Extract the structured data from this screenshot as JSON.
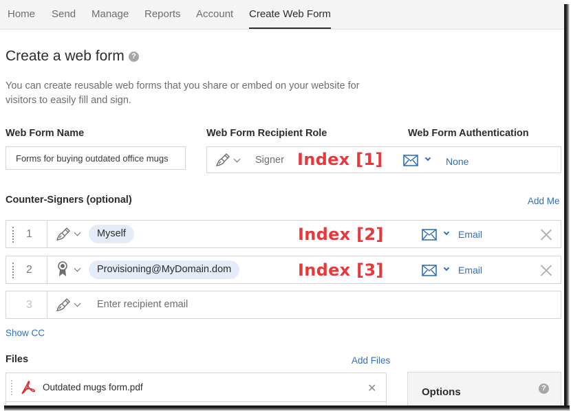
{
  "nav": {
    "items": [
      {
        "label": "Home",
        "active": false
      },
      {
        "label": "Send",
        "active": false
      },
      {
        "label": "Manage",
        "active": false
      },
      {
        "label": "Reports",
        "active": false
      },
      {
        "label": "Account",
        "active": false
      },
      {
        "label": "Create Web Form",
        "active": true
      }
    ]
  },
  "page": {
    "title": "Create a web form",
    "help_icon": "question-circle-icon",
    "description": "You can create reusable web forms that you share or embed on your website for visitors to easily fill and sign."
  },
  "web_form": {
    "name_label": "Web Form Name",
    "name_value": "Forms for buying outdated office mugs",
    "role_label": "Web Form Recipient Role",
    "auth_label": "Web Form Authentication",
    "recipient": {
      "role_icon": "pen-signer-icon",
      "role": "Signer",
      "annotation": "Index [1]",
      "auth_icon": "envelope-icon",
      "auth": "None"
    }
  },
  "counter_signers": {
    "label": "Counter-Signers (optional)",
    "add_me": "Add Me",
    "rows": [
      {
        "number": "1",
        "role_icon": "pen-signer-icon",
        "recipient": "Myself",
        "annotation": "Index [2]",
        "auth": "Email"
      },
      {
        "number": "2",
        "role_icon": "award-approver-icon",
        "recipient": "Provisioning@MyDomain.dom",
        "annotation": "Index [3]",
        "auth": "Email"
      },
      {
        "number": "3",
        "role_icon": "pen-signer-icon",
        "placeholder": "Enter recipient email"
      }
    ],
    "show_cc": "Show CC"
  },
  "files": {
    "label": "Files",
    "add_files": "Add Files",
    "items": [
      {
        "name": "Outdated mugs form.pdf",
        "icon": "pdf-icon"
      }
    ]
  },
  "options": {
    "title": "Options"
  },
  "colors": {
    "link": "#2d6fbf",
    "annotation": "#e8383b",
    "pill": "#e3ecf7",
    "nav_bg": "#f4f4f4"
  }
}
